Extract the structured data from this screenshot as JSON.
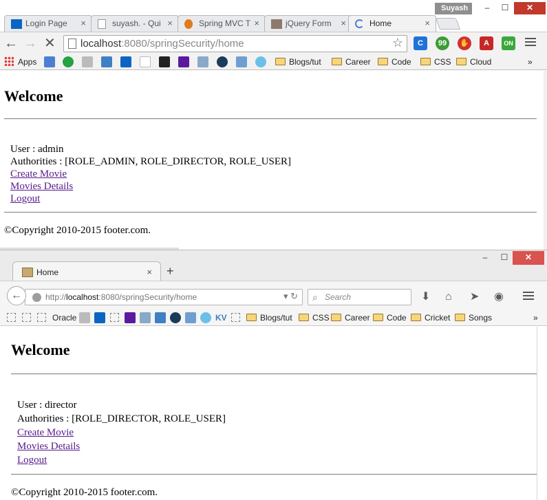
{
  "chrome": {
    "user_badge": "Suyash",
    "window_controls": {
      "minimize": "–",
      "maximize": "☐",
      "close": "✕"
    },
    "tabs": [
      {
        "label": "Login Page",
        "close": "×"
      },
      {
        "label": "suyash. - Qui",
        "close": "×"
      },
      {
        "label": "Spring MVC T",
        "close": "×"
      },
      {
        "label": "jQuery Form",
        "close": "×"
      },
      {
        "label": "Home",
        "close": "×"
      }
    ],
    "url_host": "localhost",
    "url_rest": ":8080/springSecurity/home",
    "bookmarks": {
      "apps": "Apps",
      "folders": [
        "Blogs/tut",
        "Career",
        "Code",
        "CSS",
        "Cloud"
      ],
      "overflow": "»"
    },
    "page": {
      "heading": "Welcome",
      "user_line": "User : admin",
      "authorities_line": "Authorities : [ROLE_ADMIN, ROLE_DIRECTOR, ROLE_USER]",
      "links": [
        "Create Movie",
        "Movies Details",
        "Logout"
      ],
      "footer": "©Copyright 2010-2015 footer.com."
    }
  },
  "firefox": {
    "window_controls": {
      "minimize": "–",
      "maximize": "☐",
      "close": "✕"
    },
    "tab": {
      "label": "Home",
      "close": "×"
    },
    "new_tab": "+",
    "url_prefix": "http://",
    "url_host": "localhost",
    "url_rest": ":8080/springSecurity/home",
    "search_placeholder": "Search",
    "bookmarks": {
      "items": [
        "Oracle",
        "KV"
      ],
      "folders": [
        "Blogs/tut",
        "CSS",
        "Career",
        "Code",
        "Cricket",
        "Songs"
      ],
      "overflow": "»"
    },
    "page": {
      "heading": "Welcome",
      "user_line": "User : director",
      "authorities_line": "Authorities : [ROLE_DIRECTOR, ROLE_USER]",
      "links": [
        "Create Movie",
        "Movies Details",
        "Logout"
      ],
      "footer": "©Copyright 2010-2015 footer.com."
    }
  }
}
